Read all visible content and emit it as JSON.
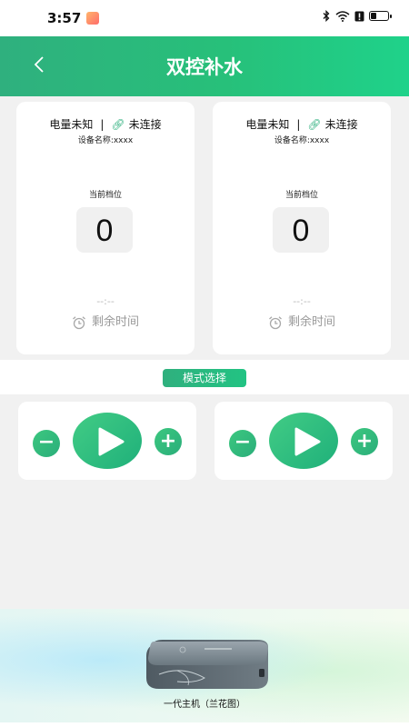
{
  "status_bar": {
    "time": "3:57",
    "icons": [
      "bluetooth-icon",
      "wifi-icon",
      "alert-icon",
      "battery-icon"
    ]
  },
  "header": {
    "back_icon": "chevron-left-icon",
    "title": "双控补水"
  },
  "devices": [
    {
      "battery_text": "电量未知",
      "separator": "|",
      "connection_icon": "link-icon",
      "connection_text": "未连接",
      "device_name": "设备名称:xxxx",
      "gear_label": "当前档位",
      "gear_value": "0",
      "countdown": "--:--",
      "remaining_label": "剩余时间"
    },
    {
      "battery_text": "电量未知",
      "separator": "|",
      "connection_icon": "link-icon",
      "connection_text": "未连接",
      "device_name": "设备名称:xxxx",
      "gear_label": "当前档位",
      "gear_value": "0",
      "countdown": "--:--",
      "remaining_label": "剩余时间"
    }
  ],
  "mode": {
    "button_label": "模式选择"
  },
  "controls": [
    {
      "minus": "−",
      "plus": "+",
      "play_icon": "play-icon"
    },
    {
      "minus": "−",
      "plus": "+",
      "play_icon": "play-icon"
    }
  ],
  "product": {
    "label": "一代主机（兰花图）"
  },
  "colors": {
    "accent": "#2fb07e",
    "header_gradient_end": "#1fd28a",
    "background": "#f1f1f1",
    "muted_text": "#9a9a9a"
  }
}
